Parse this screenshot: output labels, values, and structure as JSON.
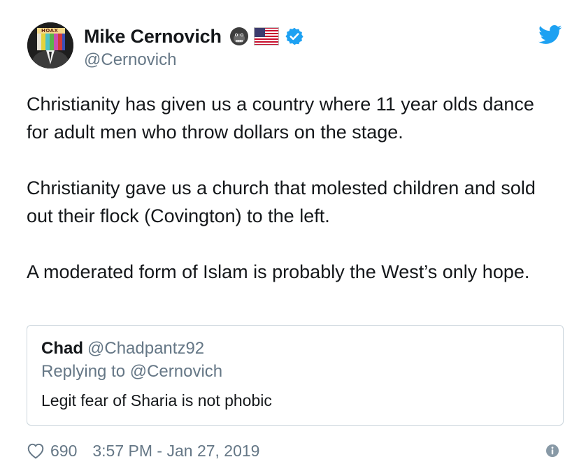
{
  "author": {
    "display_name": "Mike Cernovich",
    "handle": "@Cernovich",
    "avatar_badge_text": "HOAX",
    "name_emojis": [
      "gorilla-icon",
      "us-flag-icon"
    ],
    "verified": true
  },
  "tweet": {
    "paragraphs": [
      "Christianity has given us a country where 11 year olds dance for adult men who throw dollars on the stage.",
      "Christianity gave us a church that molested children and sold out their flock (Covington) to the left.",
      "A moderated form of Islam is probably the West’s only hope."
    ]
  },
  "quoted_tweet": {
    "display_name": "Chad",
    "handle": "@Chadpantz92",
    "replying_to": "Replying to @Cernovich",
    "text": "Legit fear of Sharia is not phobic"
  },
  "footer": {
    "likes": "690",
    "timestamp": "3:57 PM - Jan 27, 2019"
  },
  "colors": {
    "twitter_blue": "#1da1f2",
    "text": "#14171a",
    "muted": "#657786",
    "border": "#ccd6dd"
  }
}
